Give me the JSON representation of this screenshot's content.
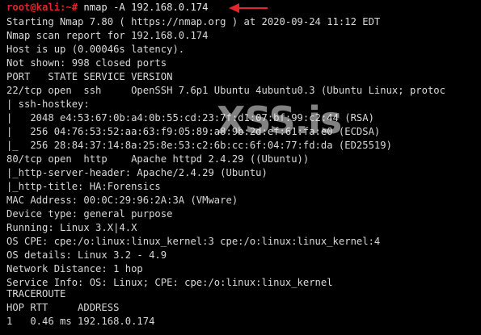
{
  "terminal": {
    "prompt": "root@kali:~#",
    "command": " nmap -A 192.168.0.174",
    "lines": [
      "Starting Nmap 7.80 ( https://nmap.org ) at 2020-09-24 11:12 EDT",
      "Nmap scan report for 192.168.0.174",
      "Host is up (0.00046s latency).",
      "Not shown: 998 closed ports",
      "PORT   STATE SERVICE VERSION",
      "22/tcp open  ssh     OpenSSH 7.6p1 Ubuntu 4ubuntu0.3 (Ubuntu Linux; protoc",
      "| ssh-hostkey:",
      "|   2048 e4:53:67:0b:a4:0b:55:cd:23:7f:d1:07:bf:99:c2:44 (RSA)",
      "|   256 04:76:53:52:aa:63:f9:05:89:a8:9b:2d:ef:61:fa:e0 (ECDSA)",
      "|_  256 28:84:37:14:8a:25:8e:53:c2:6b:cc:6f:04:77:fd:da (ED25519)",
      "80/tcp open  http    Apache httpd 2.4.29 ((Ubuntu))",
      "|_http-server-header: Apache/2.4.29 (Ubuntu)",
      "|_http-title: HA:Forensics",
      "MAC Address: 00:0C:29:96:2A:3A (VMware)",
      "Device type: general purpose",
      "Running: Linux 3.X|4.X",
      "OS CPE: cpe:/o:linux:linux_kernel:3 cpe:/o:linux:linux_kernel:4",
      "OS details: Linux 3.2 - 4.9",
      "Network Distance: 1 hop",
      "Service Info: OS: Linux; CPE: cpe:/o:linux:linux_kernel",
      "",
      "TRACEROUTE",
      "HOP RTT     ADDRESS",
      "1   0.46 ms 192.168.0.174"
    ]
  },
  "watermark": "XSS.is",
  "colors": {
    "background": "#000000",
    "prompt": "#e3242b",
    "text": "#d8d8d8",
    "arrow": "#e3242b"
  },
  "icons": {
    "annotation": "red-arrow-icon"
  }
}
